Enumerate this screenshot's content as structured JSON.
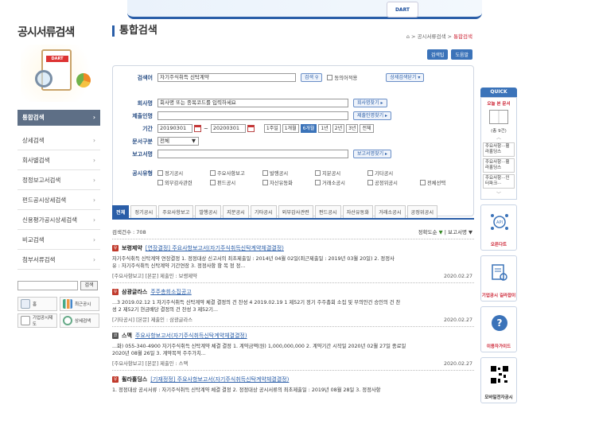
{
  "banner": {
    "logo_text": "DART"
  },
  "sidebar": {
    "title": "공시서류검색",
    "illus_tag": "DART",
    "items": [
      {
        "label": "통합검색",
        "active": true
      },
      {
        "label": "상세검색"
      },
      {
        "label": "회사별검색"
      },
      {
        "label": "정정보고서검색"
      },
      {
        "label": "펀드공시상세검색"
      },
      {
        "label": "신용평가공시상세검색"
      },
      {
        "label": "비교검색"
      },
      {
        "label": "첨부서류검색"
      }
    ],
    "search_button": "검색",
    "quick": [
      {
        "label": "홈",
        "icon": "home-icon"
      },
      {
        "label": "최근공시",
        "icon": "chart-bars-icon"
      },
      {
        "label": "기업공시제도",
        "icon": "document-icon"
      },
      {
        "label": "상세검색",
        "icon": "search-icon"
      }
    ]
  },
  "main": {
    "title": "통합검색",
    "breadcrumb": {
      "sep": ">",
      "a": "공시서류검색",
      "b": "통합검색"
    },
    "help": [
      "검색팁",
      "도움말"
    ],
    "form": {
      "keyword_label": "검색어",
      "keyword_value": "자기주식취득 신탁계약",
      "search_btn": "검색",
      "synonym": "동의어적용",
      "detail_btn": "상세검색닫기 ▾",
      "company_label": "회사명",
      "company_placeholder": "회사명 또는 종목코드를 입력하세요",
      "company_btn": "회사명찾기 ▸",
      "submitter_label": "제출인명",
      "submitter_btn": "제출인명찾기 ▸",
      "period_label": "기간",
      "date_from": "20190301",
      "date_sep": "~",
      "date_to": "20200301",
      "periods": [
        "1주일",
        "1개월",
        "6개월",
        "1년",
        "2년",
        "3년",
        "전체"
      ],
      "active_period": "6개월",
      "doc_type_label": "문서구분",
      "doc_type_value": "전체",
      "report_label": "보고서명",
      "report_btn": "보고서명찾기 ▸",
      "pub_type_label": "공시유형",
      "pub_types_row1": [
        "정기공시",
        "주요사항보고",
        "발행공시",
        "지분공시",
        "기타공시"
      ],
      "pub_types_row2": [
        "외부감사관련",
        "펀드공시",
        "자산유동화",
        "거래소공시",
        "공정위공시"
      ],
      "select_all": "전체선택"
    },
    "tabs": [
      "전체",
      "정기공시",
      "주요사항보고",
      "발행공시",
      "지분공시",
      "기타공시",
      "외부감사관련",
      "펀드공시",
      "자산유동화",
      "거래소공시",
      "공정위공시"
    ],
    "result_count": "검색건수 : 708",
    "sort": {
      "a": "정확도순",
      "b": "보고서명"
    },
    "results": [
      {
        "badge": "유",
        "company": "보령제약",
        "title": "[연장결정] 주요사항보고서(자기주식취득신탁계약체결결정)",
        "snip1": "자기주식취득 신탁계약 연장결정 1. 정정대상 신고서의 최초제출일 : 2014년 04월 02일(최근제출일 : 2019년 03월 20일) 2. 정정사",
        "snip2": "유 : 자기주식취득 신탁계약 기간연장 3. 정정사항 항 목 정 정...",
        "meta": "[주요사항보고] [본문] 제출인 : 보령제약",
        "date": "2020.02.27"
      },
      {
        "badge": "유",
        "company": "삼광글라스",
        "title": "주주총회소집공고",
        "snip1": "...3 2019.02.12 1 자기주식취득 신탁계약 체결 결정의 건 찬성 4 2019.02.19 1 제52기 정기 주주총회 소집 및 부의안건 승인의 건 찬",
        "snip2": "성 2 제52기 현금배당 결정의 건 찬성 3 제52기...",
        "meta": "[기타공시] [본문] 제출인 : 삼광글라스",
        "date": "2020.02.27"
      },
      {
        "badge": "코",
        "company": "스맥",
        "title": "주요사항보고서(자기주식취득신탁계약체결결정)",
        "snip1": "...화) 055-340-4900 자기주식취득 신탁계약 체결 결정 1. 계약금액(원) 1,000,000,000 2. 계약기간 시작일 2020년 02월 27일 종료일",
        "snip2": "2020년 08월 26일 3. 계약목적 주주가치...",
        "meta": "[주요사항보고] [본문] 제출인 : 스맥",
        "date": "2020.02.27"
      },
      {
        "badge": "유",
        "company": "휠라홀딩스",
        "title": "[기재정정] 주요사항보고서(자기주식취득신탁계약체결결정)",
        "snip1": "1. 정정대상 공시서류 : 자기주식취득 신탁계약 체결 결정 2. 정정대상 공시서류의 최초제출일 : 2019년 08월 28일 3. 정정사항",
        "snip2": "",
        "meta": "",
        "date": ""
      }
    ]
  },
  "quickbar": {
    "head": "QUICK",
    "sub": "오늘 본 문서",
    "count": "(총 9건)",
    "items": [
      "주요사항···휠라홀딩스",
      "주요사항···휠라홀딩스",
      "주요사항···인터파크···"
    ],
    "cards": [
      "오픈다트",
      "기업공시 길라잡이",
      "이용자가이드",
      "모바일전자공시"
    ]
  }
}
